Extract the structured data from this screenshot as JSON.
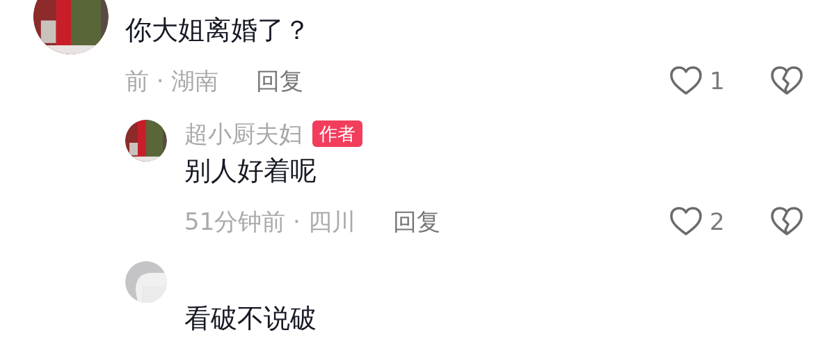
{
  "comments": [
    {
      "text": "你大姐离婚了？",
      "meta": "前 · 湖南",
      "reply_label": "回复",
      "likes": "1",
      "replies": [
        {
          "author": "超小厨夫妇",
          "badge": "作者",
          "text": "别人好着呢",
          "meta": "51分钟前 · 四川",
          "reply_label": "回复",
          "likes": "2"
        },
        {
          "avatar": {
            "kind": "default"
          },
          "text": "看破不说破"
        }
      ]
    }
  ]
}
